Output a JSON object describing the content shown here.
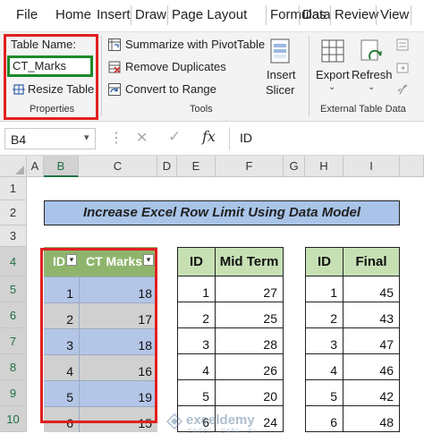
{
  "tabs": [
    "File",
    "Home",
    "Insert",
    "Draw",
    "Page Layout",
    "Formulas",
    "Data",
    "Review",
    "View"
  ],
  "ribbon": {
    "table_name_label": "Table Name:",
    "table_name_value": "CT_Marks",
    "resize_table": "Resize Table",
    "properties_group": "Properties",
    "summarize": "Summarize with PivotTable",
    "remove_duplicates": "Remove Duplicates",
    "convert_to_range": "Convert to Range",
    "tools_group": "Tools",
    "insert_slicer_line1": "Insert",
    "insert_slicer_line2": "Slicer",
    "export": "Export",
    "refresh": "Refresh",
    "external_group": "External Table Data"
  },
  "formula_bar": {
    "name_box": "B4",
    "fx": "fx",
    "content": "ID"
  },
  "columns": [
    "A",
    "B",
    "C",
    "D",
    "E",
    "F",
    "G",
    "H",
    "I"
  ],
  "rows": [
    "1",
    "2",
    "3",
    "4",
    "5",
    "6",
    "7",
    "8",
    "9",
    "10"
  ],
  "sheet": {
    "title": "Increase Excel Row Limit Using Data Model",
    "ct_table": {
      "headers": [
        "ID",
        "CT Marks"
      ],
      "ids": [
        "1",
        "2",
        "3",
        "4",
        "5",
        "6"
      ],
      "marks": [
        "18",
        "17",
        "18",
        "16",
        "19",
        "15"
      ]
    },
    "midterm_table": {
      "headers": [
        "ID",
        "Mid Term"
      ],
      "ids": [
        "1",
        "2",
        "3",
        "4",
        "5",
        "6"
      ],
      "marks": [
        "27",
        "25",
        "28",
        "26",
        "20",
        "24"
      ]
    },
    "final_table": {
      "headers": [
        "ID",
        "Final"
      ],
      "ids": [
        "1",
        "2",
        "3",
        "4",
        "5",
        "6"
      ],
      "marks": [
        "45",
        "43",
        "47",
        "46",
        "42",
        "48"
      ]
    }
  },
  "watermark": "exceldemy",
  "watermark_sub": "EXCEL · DATA · BI",
  "colors": {
    "accent_green": "#217346",
    "highlight_red": "#e02020",
    "title_fill": "#a9c4e8",
    "header_green": "#c6e0b4",
    "table_blue": "#b4c6e7",
    "table_grey": "#d0d0d0"
  }
}
